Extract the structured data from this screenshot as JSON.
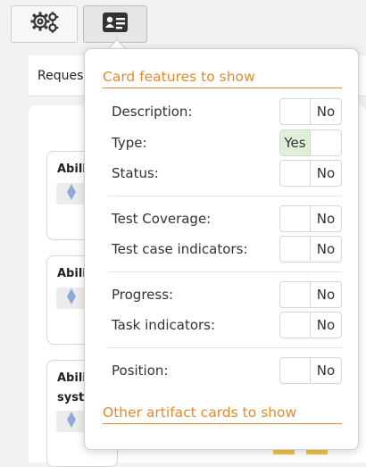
{
  "toolbar": {
    "settings_icon": "gears-icon",
    "card_icon": "id-card-icon"
  },
  "tabbar": {
    "tab_label": "Reques"
  },
  "board": {
    "cards": [
      {
        "title": "Abili"
      },
      {
        "title": "Abili"
      },
      {
        "title": "Abili",
        "title_line2": "syste"
      }
    ],
    "type_icon_color": "#8fa9d9"
  },
  "popup": {
    "section_card_features": "Card features to show",
    "section_other_cards": "Other artifact cards to show",
    "options": [
      {
        "label": "Description:",
        "value": "No"
      },
      {
        "label": "Type:",
        "value": "Yes"
      },
      {
        "label": "Status:",
        "value": "No"
      },
      {
        "label": "Test Coverage:",
        "value": "No"
      },
      {
        "label": "Test case indicators:",
        "value": "No"
      },
      {
        "label": "Progress:",
        "value": "No"
      },
      {
        "label": "Task indicators:",
        "value": "No"
      },
      {
        "label": "Position:",
        "value": "No"
      }
    ],
    "colors": {
      "accent": "#e38b2c",
      "yes_bg": "#dff0d8"
    }
  }
}
